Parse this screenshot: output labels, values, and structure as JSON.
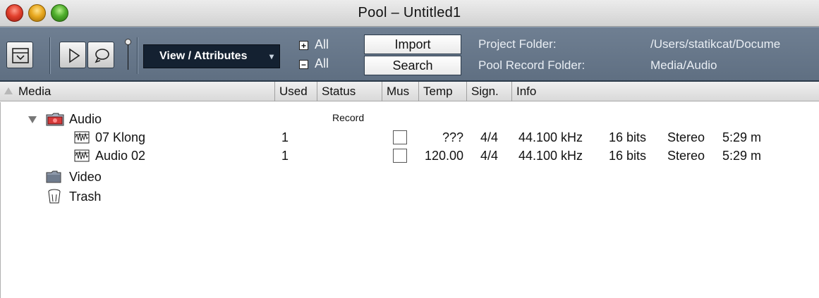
{
  "window": {
    "title": "Pool – Untitled1"
  },
  "toolbar": {
    "view_attributes_label": "View / Attributes",
    "expand_all_label": "All",
    "collapse_all_label": "All",
    "import_label": "Import",
    "search_label": "Search",
    "project_folder_label": "Project Folder:",
    "project_folder_value": "/Users/statikcat/Docume",
    "pool_record_folder_label": "Pool Record Folder:",
    "pool_record_folder_value": "Media/Audio"
  },
  "columns": {
    "media": "Media",
    "used": "Used",
    "status": "Status",
    "mus": "Mus",
    "tempo": "Temp",
    "sign": "Sign.",
    "info": "Info"
  },
  "tree": {
    "audio_folder": {
      "label": "Audio",
      "status": "Record"
    },
    "items": [
      {
        "name": "07 Klong",
        "used": "1",
        "tempo": "???",
        "sign": "4/4",
        "rate": "44.100 kHz",
        "bits": "16 bits",
        "channels": "Stereo",
        "length": "5:29 m"
      },
      {
        "name": "Audio 02",
        "used": "1",
        "tempo": "120.00",
        "sign": "4/4",
        "rate": "44.100 kHz",
        "bits": "16 bits",
        "channels": "Stereo",
        "length": "5:29 m"
      }
    ],
    "video_folder": {
      "label": "Video"
    },
    "trash_folder": {
      "label": "Trash"
    }
  }
}
